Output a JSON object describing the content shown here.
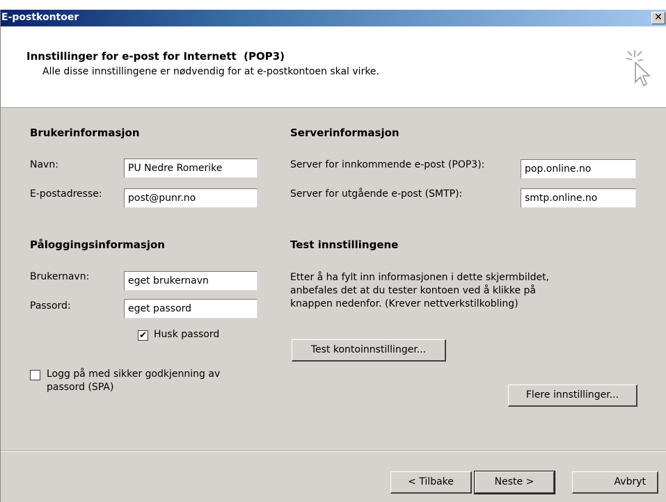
{
  "window": {
    "title": "E-postkontoer",
    "close_glyph": "✕"
  },
  "header": {
    "title": "Innstillinger for e-post for Internett  (POP3)",
    "description": "Alle disse innstillingene er nødvendig for at e-postkontoen skal virke.",
    "icon": "wizard-cursor-icon"
  },
  "user_info": {
    "heading": "Brukerinformasjon",
    "name_label": "Navn:",
    "name_value": "PU Nedre Romerike",
    "email_label": "E-postadresse:",
    "email_value": "post@punr.no"
  },
  "server_info": {
    "heading": "Serverinformasjon",
    "incoming_label": "Server for innkommende e-post (POP3):",
    "incoming_value": "pop.online.no",
    "outgoing_label": "Server for utgående e-post (SMTP):",
    "outgoing_value": "smtp.online.no"
  },
  "login_info": {
    "heading": "Påloggingsinformasjon",
    "username_label": "Brukernavn:",
    "username_value": "eget brukernavn",
    "password_label": "Passord:",
    "password_value": "eget passord",
    "remember_label": "Husk passord",
    "remember_checked": true,
    "spa_label_line1": "Logg på med sikker godkjenning av",
    "spa_label_line2": "passord (SPA)",
    "spa_checked": false
  },
  "test": {
    "heading": "Test innstillingene",
    "line1": "Etter å ha fylt inn informasjonen i dette skjermbildet,",
    "line2": "anbefales det at du tester kontoen ved å klikke på",
    "line3": "knappen nedenfor. (Krever nettverkstilkobling)",
    "test_button": "Test kontoinnstillinger...",
    "more_button": "Flere innstillinger..."
  },
  "footer": {
    "back": "< Tilbake",
    "next": "Neste >",
    "cancel": "Avbryt"
  }
}
